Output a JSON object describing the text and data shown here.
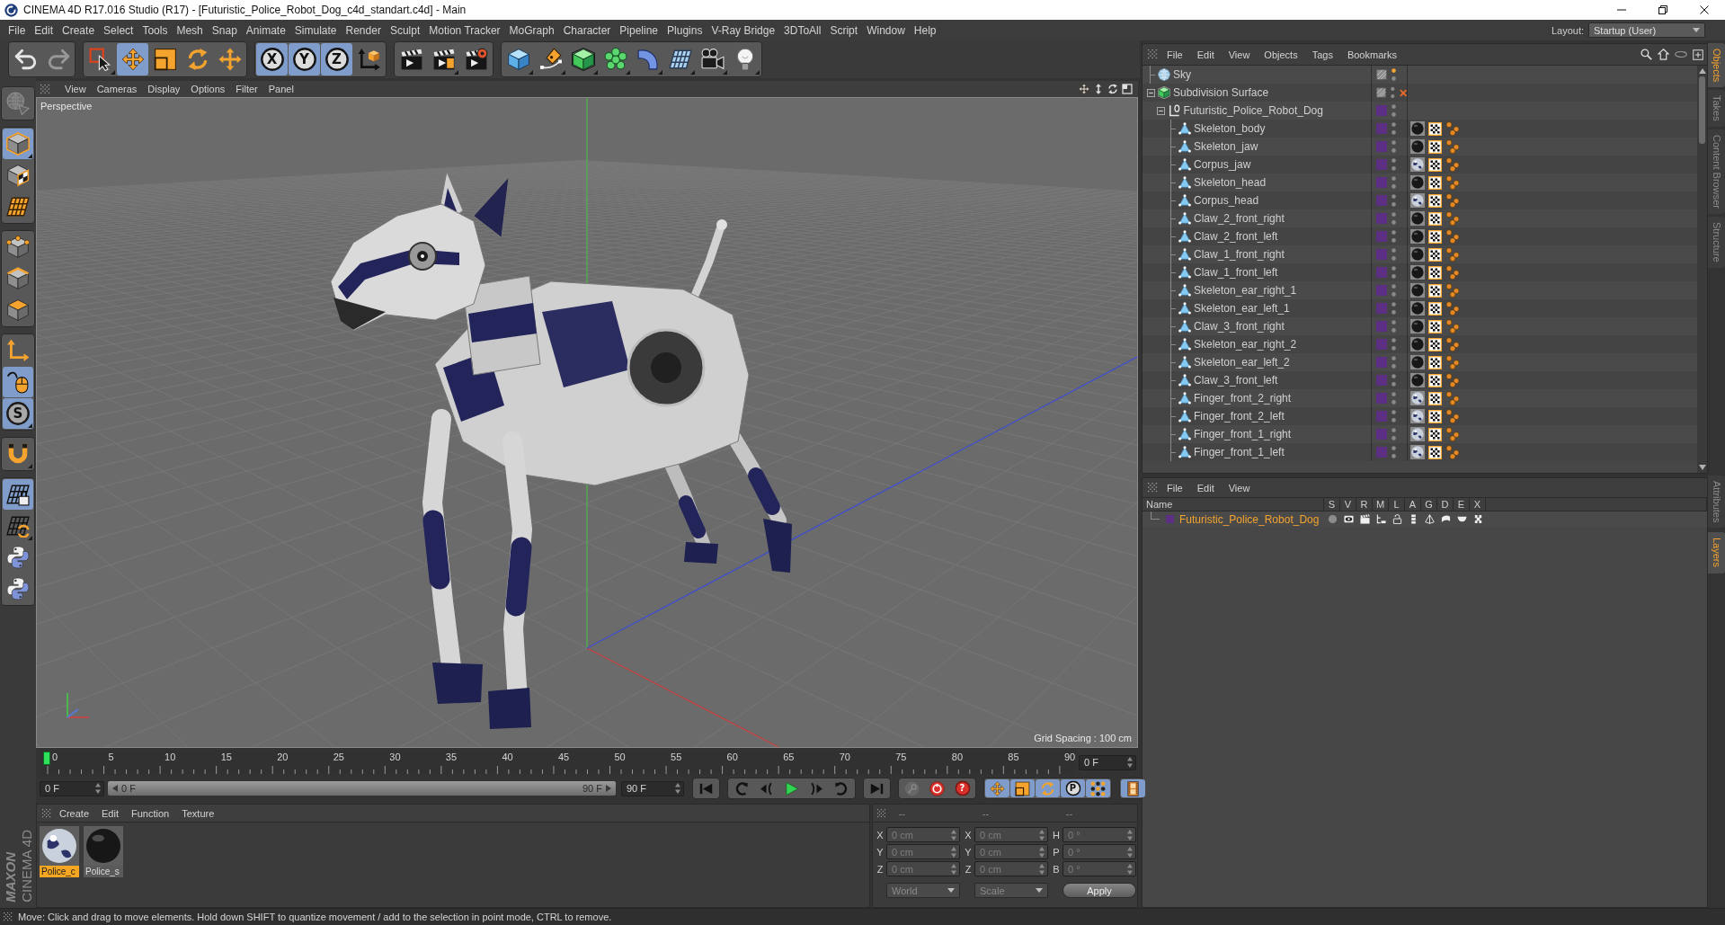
{
  "window": {
    "title": "CINEMA 4D R17.016 Studio (R17) - [Futuristic_Police_Robot_Dog_c4d_standart.c4d] - Main"
  },
  "menu_bar": {
    "items": [
      "File",
      "Edit",
      "Create",
      "Select",
      "Tools",
      "Mesh",
      "Snap",
      "Animate",
      "Simulate",
      "Render",
      "Sculpt",
      "Motion Tracker",
      "MoGraph",
      "Character",
      "Pipeline",
      "Plugins",
      "V-Ray Bridge",
      "3DToAll",
      "Script",
      "Window",
      "Help"
    ],
    "layout_label": "Layout:",
    "layout_value": "Startup (User)"
  },
  "toolbar": {
    "groups": [
      {
        "buttons": [
          {
            "kind": "undo",
            "active": false,
            "disabled": false,
            "submenu": false
          },
          {
            "kind": "redo",
            "active": false,
            "disabled": true,
            "submenu": false
          }
        ]
      },
      {
        "buttons": [
          {
            "kind": "select",
            "active": false,
            "disabled": false,
            "submenu": true
          },
          {
            "kind": "move",
            "active": true,
            "disabled": false,
            "submenu": false
          },
          {
            "kind": "scale",
            "active": false,
            "disabled": false,
            "submenu": false
          },
          {
            "kind": "rotate",
            "active": false,
            "disabled": false,
            "submenu": false
          },
          {
            "kind": "recent",
            "active": false,
            "disabled": false,
            "submenu": false
          }
        ]
      },
      {
        "buttons": [
          {
            "kind": "axis",
            "label": "X",
            "active": true,
            "disabled": false,
            "submenu": false
          },
          {
            "kind": "axis",
            "label": "Y",
            "active": true,
            "disabled": false,
            "submenu": false
          },
          {
            "kind": "axis",
            "label": "Z",
            "active": true,
            "disabled": false,
            "submenu": false
          },
          {
            "kind": "coordsystem",
            "active": false,
            "disabled": false,
            "submenu": false
          }
        ]
      },
      {
        "buttons": [
          {
            "kind": "renderview",
            "active": false,
            "disabled": false,
            "submenu": false
          },
          {
            "kind": "renderpicture",
            "active": false,
            "disabled": false,
            "submenu": true
          },
          {
            "kind": "rendersettings",
            "active": false,
            "disabled": false,
            "submenu": false
          }
        ]
      },
      {
        "buttons": [
          {
            "kind": "cube",
            "active": false,
            "disabled": false,
            "submenu": true
          },
          {
            "kind": "pen",
            "active": false,
            "disabled": false,
            "submenu": true
          },
          {
            "kind": "subdivision",
            "active": false,
            "disabled": false,
            "submenu": true
          },
          {
            "kind": "cloner",
            "active": false,
            "disabled": false,
            "submenu": true
          },
          {
            "kind": "deformer",
            "active": false,
            "disabled": false,
            "submenu": true
          },
          {
            "kind": "floor",
            "active": false,
            "disabled": false,
            "submenu": true
          },
          {
            "kind": "camera",
            "active": false,
            "disabled": false,
            "submenu": true
          },
          {
            "kind": "light",
            "active": false,
            "disabled": false,
            "submenu": true
          }
        ]
      }
    ]
  },
  "left_toolbar": {
    "groups": [
      {
        "buttons": [
          {
            "kind": "editable",
            "active": false,
            "disabled": true,
            "submenu": false
          }
        ]
      },
      {
        "buttons": [
          {
            "kind": "model",
            "active": true,
            "disabled": false,
            "submenu": true
          },
          {
            "kind": "texture",
            "active": false,
            "disabled": false,
            "submenu": false
          },
          {
            "kind": "workplane",
            "active": false,
            "disabled": false,
            "submenu": false
          }
        ]
      },
      {
        "buttons": [
          {
            "kind": "points",
            "active": false,
            "disabled": false,
            "submenu": false
          },
          {
            "kind": "edges",
            "active": false,
            "disabled": false,
            "submenu": false
          },
          {
            "kind": "polygons",
            "active": false,
            "disabled": false,
            "submenu": false
          }
        ]
      },
      {
        "buttons": [
          {
            "kind": "axismode",
            "active": false,
            "disabled": false,
            "submenu": false
          },
          {
            "kind": "tweak",
            "active": true,
            "disabled": false,
            "submenu": false
          },
          {
            "kind": "solo",
            "label": "S",
            "active": true,
            "disabled": false,
            "submenu": true
          }
        ]
      },
      {
        "buttons": [
          {
            "kind": "snap",
            "active": false,
            "disabled": false,
            "submenu": true
          }
        ]
      },
      {
        "buttons": [
          {
            "kind": "lockgrid",
            "active": true,
            "disabled": false,
            "submenu": false
          },
          {
            "kind": "gridsync",
            "active": false,
            "disabled": false,
            "submenu": true
          },
          {
            "kind": "python",
            "active": false,
            "disabled": false,
            "submenu": false
          },
          {
            "kind": "python",
            "active": false,
            "disabled": false,
            "submenu": false
          }
        ]
      }
    ]
  },
  "viewport": {
    "menu": [
      "View",
      "Cameras",
      "Display",
      "Options",
      "Filter",
      "Panel"
    ],
    "camera": "Perspective",
    "grid_spacing": "Grid Spacing : 100 cm"
  },
  "timeline": {
    "ticks": [
      "0",
      "5",
      "10",
      "15",
      "20",
      "25",
      "30",
      "35",
      "40",
      "45",
      "50",
      "55",
      "60",
      "65",
      "70",
      "75",
      "80",
      "85",
      "90"
    ],
    "playhead": {
      "level": 0
    },
    "frame_field": "0 F"
  },
  "transport": {
    "start_field": "0 F",
    "range": {
      "start": "0 F",
      "end": "90 F",
      "level": 1
    },
    "end_field": "90 F",
    "groups": [
      {
        "buttons": [
          {
            "kind": "gostart",
            "active": false,
            "disabled": false
          }
        ]
      },
      {
        "buttons": [
          {
            "kind": "prevkey",
            "active": false,
            "disabled": false
          },
          {
            "kind": "prevframe",
            "active": false,
            "disabled": false
          },
          {
            "kind": "play",
            "active": false,
            "disabled": false
          },
          {
            "kind": "nextframe",
            "active": false,
            "disabled": false
          },
          {
            "kind": "nextkey",
            "active": false,
            "disabled": false
          }
        ]
      },
      {
        "buttons": [
          {
            "kind": "goend",
            "active": false,
            "disabled": false
          }
        ]
      },
      {
        "buttons": [
          {
            "kind": "record",
            "active": false,
            "disabled": true
          },
          {
            "kind": "autokey",
            "active": false,
            "disabled": false
          },
          {
            "kind": "keyhelp",
            "label": "?",
            "active": false,
            "disabled": false
          }
        ]
      },
      {
        "buttons": [
          {
            "kind": "keymove",
            "active": true,
            "disabled": false
          },
          {
            "kind": "keyscale",
            "active": true,
            "disabled": false
          },
          {
            "kind": "keyrotate",
            "active": true,
            "disabled": false
          },
          {
            "kind": "keyparam",
            "label": "P",
            "active": true,
            "disabled": false
          },
          {
            "kind": "keypoints",
            "active": true,
            "disabled": false
          }
        ]
      },
      {
        "buttons": [
          {
            "kind": "timeline",
            "active": true,
            "disabled": false
          }
        ]
      }
    ]
  },
  "logo": {
    "brand": "MAXON",
    "product": "CINEMA 4D"
  },
  "material_manager": {
    "menu": [
      "Create",
      "Edit",
      "Function",
      "Texture"
    ],
    "materials": [
      {
        "name": "Police_c",
        "kind": "textured",
        "selected": true
      },
      {
        "name": "Police_s",
        "kind": "dark",
        "selected": false
      }
    ]
  },
  "coordinates": {
    "headers": [
      "--",
      "--",
      "--"
    ],
    "disabled": true,
    "rows": [
      [
        {
          "axis": "X",
          "value": "0 cm"
        },
        {
          "axis": "X",
          "value": "0 cm"
        },
        {
          "axis": "H",
          "value": "0 °"
        }
      ],
      [
        {
          "axis": "Y",
          "value": "0 cm"
        },
        {
          "axis": "Y",
          "value": "0 cm"
        },
        {
          "axis": "P",
          "value": "0 °"
        }
      ],
      [
        {
          "axis": "Z",
          "value": "0 cm"
        },
        {
          "axis": "Z",
          "value": "0 cm"
        },
        {
          "axis": "B",
          "value": "0 °"
        }
      ]
    ],
    "dropdowns": [
      "World",
      "Scale"
    ],
    "apply": "Apply"
  },
  "object_manager": {
    "menu": [
      "File",
      "Edit",
      "View",
      "Objects",
      "Tags",
      "Bookmarks"
    ],
    "objects": [
      {
        "name": "Sky",
        "kind": "sky",
        "selected": false,
        "editor_dot_on": true,
        "disabled": false
      },
      {
        "name": "Subdivision Surface",
        "kind": "subdivision",
        "selected": false,
        "editor_dot_on": false,
        "disabled": true,
        "expanded": true,
        "children": [
          {
            "name": "Futuristic_Police_Robot_Dog",
            "kind": "null",
            "color": "#5c2e84",
            "selected": false,
            "editor_dot_on": false,
            "disabled": false,
            "expanded": true,
            "children": [
              {
                "name": "Skeleton_body",
                "kind": "joint",
                "color": "#5c2e84",
                "selected": false,
                "editor_dot_on": false,
                "disabled": false,
                "tags": [
                  {
                    "kind": "darkmaterial"
                  },
                  {
                    "kind": "checker"
                  },
                  {
                    "kind": "weight"
                  }
                ]
              },
              {
                "name": "Skeleton_jaw",
                "kind": "joint",
                "color": "#5c2e84",
                "selected": false,
                "editor_dot_on": false,
                "disabled": false,
                "tags": [
                  {
                    "kind": "darkmaterial"
                  },
                  {
                    "kind": "checker"
                  },
                  {
                    "kind": "weight"
                  }
                ]
              },
              {
                "name": "Corpus_jaw",
                "kind": "joint",
                "color": "#5c2e84",
                "selected": false,
                "editor_dot_on": false,
                "disabled": false,
                "tags": [
                  {
                    "kind": "lightmaterial"
                  },
                  {
                    "kind": "checker"
                  },
                  {
                    "kind": "weight"
                  }
                ]
              },
              {
                "name": "Skeleton_head",
                "kind": "joint",
                "color": "#5c2e84",
                "selected": false,
                "editor_dot_on": false,
                "disabled": false,
                "tags": [
                  {
                    "kind": "darkmaterial"
                  },
                  {
                    "kind": "checker"
                  },
                  {
                    "kind": "weight"
                  }
                ]
              },
              {
                "name": "Corpus_head",
                "kind": "joint",
                "color": "#5c2e84",
                "selected": false,
                "editor_dot_on": false,
                "disabled": false,
                "tags": [
                  {
                    "kind": "lightmaterial"
                  },
                  {
                    "kind": "checker"
                  },
                  {
                    "kind": "weight"
                  }
                ]
              },
              {
                "name": "Claw_2_front_right",
                "kind": "joint",
                "color": "#5c2e84",
                "selected": false,
                "editor_dot_on": false,
                "disabled": false,
                "tags": [
                  {
                    "kind": "darkmaterial"
                  },
                  {
                    "kind": "checker"
                  },
                  {
                    "kind": "weight"
                  }
                ]
              },
              {
                "name": "Claw_2_front_left",
                "kind": "joint",
                "color": "#5c2e84",
                "selected": false,
                "editor_dot_on": false,
                "disabled": false,
                "tags": [
                  {
                    "kind": "darkmaterial"
                  },
                  {
                    "kind": "checker"
                  },
                  {
                    "kind": "weight"
                  }
                ]
              },
              {
                "name": "Claw_1_front_right",
                "kind": "joint",
                "color": "#5c2e84",
                "selected": false,
                "editor_dot_on": false,
                "disabled": false,
                "tags": [
                  {
                    "kind": "darkmaterial"
                  },
                  {
                    "kind": "checker"
                  },
                  {
                    "kind": "weight"
                  }
                ]
              },
              {
                "name": "Claw_1_front_left",
                "kind": "joint",
                "color": "#5c2e84",
                "selected": false,
                "editor_dot_on": false,
                "disabled": false,
                "tags": [
                  {
                    "kind": "darkmaterial"
                  },
                  {
                    "kind": "checker"
                  },
                  {
                    "kind": "weight"
                  }
                ]
              },
              {
                "name": "Skeleton_ear_right_1",
                "kind": "joint",
                "color": "#5c2e84",
                "selected": false,
                "editor_dot_on": false,
                "disabled": false,
                "tags": [
                  {
                    "kind": "darkmaterial"
                  },
                  {
                    "kind": "checker"
                  },
                  {
                    "kind": "weight"
                  }
                ]
              },
              {
                "name": "Skeleton_ear_left_1",
                "kind": "joint",
                "color": "#5c2e84",
                "selected": false,
                "editor_dot_on": false,
                "disabled": false,
                "tags": [
                  {
                    "kind": "darkmaterial"
                  },
                  {
                    "kind": "checker"
                  },
                  {
                    "kind": "weight"
                  }
                ]
              },
              {
                "name": "Claw_3_front_right",
                "kind": "joint",
                "color": "#5c2e84",
                "selected": false,
                "editor_dot_on": false,
                "disabled": false,
                "tags": [
                  {
                    "kind": "darkmaterial"
                  },
                  {
                    "kind": "checker"
                  },
                  {
                    "kind": "weight"
                  }
                ]
              },
              {
                "name": "Skeleton_ear_right_2",
                "kind": "joint",
                "color": "#5c2e84",
                "selected": false,
                "editor_dot_on": false,
                "disabled": false,
                "tags": [
                  {
                    "kind": "darkmaterial"
                  },
                  {
                    "kind": "checker"
                  },
                  {
                    "kind": "weight"
                  }
                ]
              },
              {
                "name": "Skeleton_ear_left_2",
                "kind": "joint",
                "color": "#5c2e84",
                "selected": false,
                "editor_dot_on": false,
                "disabled": false,
                "tags": [
                  {
                    "kind": "darkmaterial"
                  },
                  {
                    "kind": "checker"
                  },
                  {
                    "kind": "weight"
                  }
                ]
              },
              {
                "name": "Claw_3_front_left",
                "kind": "joint",
                "color": "#5c2e84",
                "selected": false,
                "editor_dot_on": false,
                "disabled": false,
                "tags": [
                  {
                    "kind": "darkmaterial"
                  },
                  {
                    "kind": "checker"
                  },
                  {
                    "kind": "weight"
                  }
                ]
              },
              {
                "name": "Finger_front_2_right",
                "kind": "joint",
                "color": "#5c2e84",
                "selected": false,
                "editor_dot_on": false,
                "disabled": false,
                "tags": [
                  {
                    "kind": "lightmaterial"
                  },
                  {
                    "kind": "checker"
                  },
                  {
                    "kind": "weight"
                  }
                ]
              },
              {
                "name": "Finger_front_2_left",
                "kind": "joint",
                "color": "#5c2e84",
                "selected": false,
                "editor_dot_on": false,
                "disabled": false,
                "tags": [
                  {
                    "kind": "lightmaterial"
                  },
                  {
                    "kind": "checker"
                  },
                  {
                    "kind": "weight"
                  }
                ]
              },
              {
                "name": "Finger_front_1_right",
                "kind": "joint",
                "color": "#5c2e84",
                "selected": false,
                "editor_dot_on": false,
                "disabled": false,
                "tags": [
                  {
                    "kind": "lightmaterial"
                  },
                  {
                    "kind": "checker"
                  },
                  {
                    "kind": "weight"
                  }
                ]
              },
              {
                "name": "Finger_front_1_left",
                "kind": "joint",
                "color": "#5c2e84",
                "selected": false,
                "editor_dot_on": false,
                "disabled": false,
                "tags": [
                  {
                    "kind": "lightmaterial"
                  },
                  {
                    "kind": "checker"
                  },
                  {
                    "kind": "weight"
                  }
                ]
              }
            ]
          }
        ]
      }
    ]
  },
  "object_tabs": [
    {
      "label": "Objects",
      "selected": true
    },
    {
      "label": "Takes",
      "selected": false
    },
    {
      "label": "Content Browser",
      "selected": false
    },
    {
      "label": "Structure",
      "selected": false
    }
  ],
  "layer_manager": {
    "menu": [
      "File",
      "Edit",
      "View"
    ],
    "columns": [
      "Name",
      "S",
      "V",
      "R",
      "M",
      "L",
      "A",
      "G",
      "D",
      "E",
      "X"
    ],
    "layers": [
      {
        "name": "Futuristic_Police_Robot_Dog",
        "color": "#5c2e84",
        "selected": true,
        "flags": [
          {
            "kind": "solo",
            "on": false
          },
          {
            "kind": "view",
            "on": true
          },
          {
            "kind": "render",
            "on": true
          },
          {
            "kind": "manager",
            "on": true
          },
          {
            "kind": "lock",
            "on": false
          },
          {
            "kind": "animation",
            "on": true
          },
          {
            "kind": "generators",
            "on": true
          },
          {
            "kind": "deformers",
            "on": true
          },
          {
            "kind": "expressions",
            "on": true
          },
          {
            "kind": "xrefs",
            "on": true
          }
        ]
      }
    ]
  },
  "panel_tabs": [
    {
      "label": "Attributes",
      "selected": false
    },
    {
      "label": "Layers",
      "selected": true
    }
  ],
  "status_bar": {
    "text": "Move: Click and drag to move elements. Hold down SHIFT to quantize movement / add to the selection in point mode, CTRL to remove."
  }
}
